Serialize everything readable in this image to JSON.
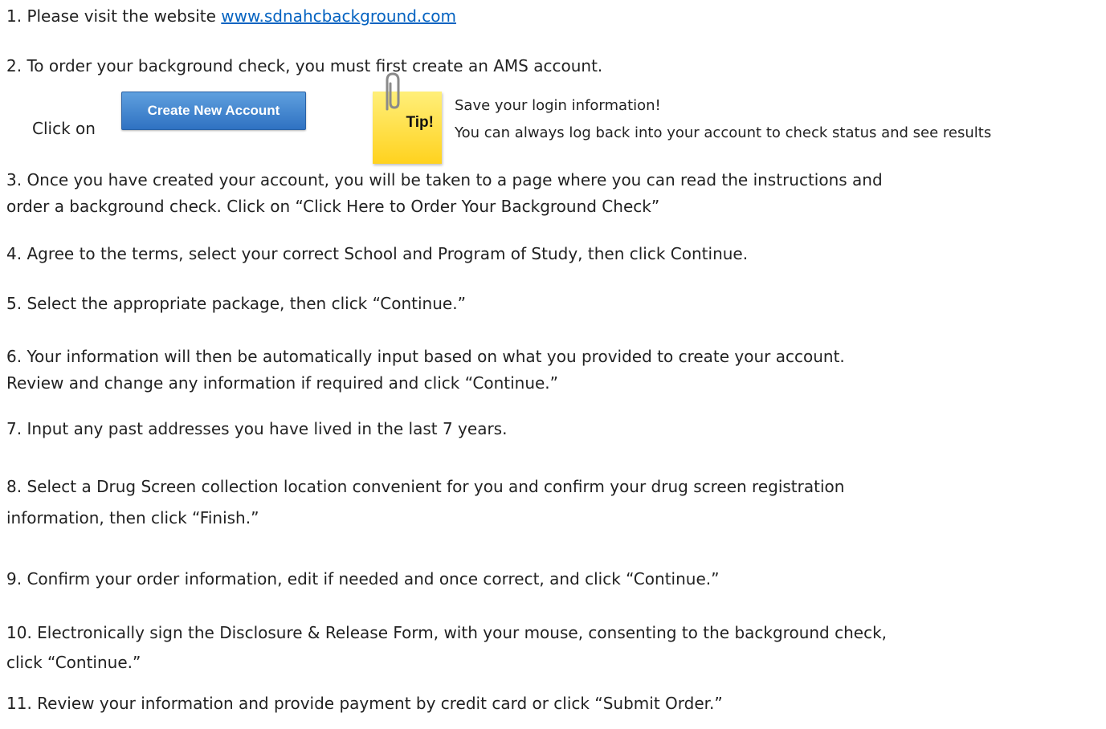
{
  "steps": [
    {
      "prefix": "1.  Please visit the website ",
      "link": "www.sdnahcbackground.com"
    },
    {
      "text": "2.  To order your background check, you must first create an AMS account."
    },
    {
      "line1": "3.  Once you have created your account, you will be taken to a page where you can read the instructions and",
      "line2": "order a background check. Click on “Click Here to Order Your Background Check”"
    },
    {
      "text": "4.  Agree to the terms, select your correct School and Program of Study, then click Continue."
    },
    {
      "text": "5. Select the appropriate package, then click “Continue.”"
    },
    {
      "line1": "6.  Your information will then be automatically input based on what you provided to create your account.",
      "line2": "Review and change any information if required and click “Continue.”"
    },
    {
      "text": "7.  Input any past addresses you have lived in the last 7 years."
    },
    {
      "line1": "8.  Select a Drug Screen collection location convenient for you and confirm your drug screen registration",
      "line2": "information, then click “Finish.”"
    },
    {
      "text": "9. Confirm your order information, edit if needed and once correct, and click “Continue.”"
    },
    {
      "line1": "10.  Electronically sign the Disclosure & Release Form, with your mouse, consenting to the background check,",
      "line2": "click “Continue.”"
    },
    {
      "text": "11.  Review your information and provide payment by credit card or click “Submit Order.”"
    }
  ],
  "click_on": "Click on",
  "create_button": "Create New Account",
  "tip": {
    "label": "Tip!",
    "line1": "Save your login information!",
    "line2": "You can always log back into your account to check status and see results",
    "icon": "paperclip-icon"
  }
}
